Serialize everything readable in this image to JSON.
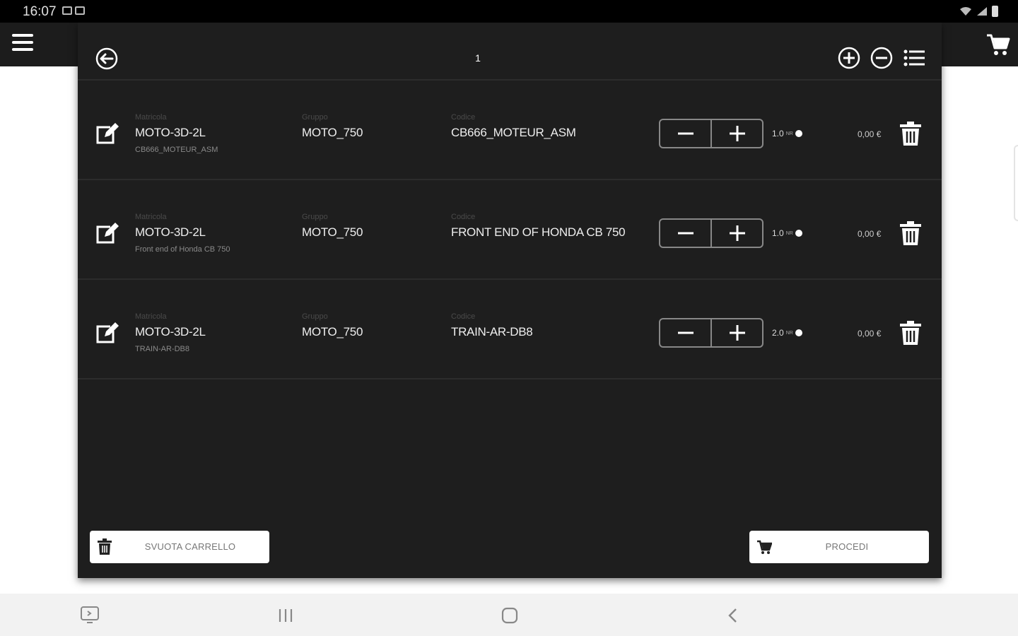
{
  "status": {
    "time": "16:07"
  },
  "header": {
    "title": "1"
  },
  "labels": {
    "matricola": "Matricola",
    "gruppo": "Gruppo",
    "codice": "Codice"
  },
  "items": [
    {
      "matricola": "MOTO-3D-2L",
      "description": "CB666_MOTEUR_ASM",
      "gruppo": "MOTO_750",
      "codice": "CB666_MOTEUR_ASM",
      "qty": "1.0",
      "unit": "NR",
      "price": "0,00 €"
    },
    {
      "matricola": "MOTO-3D-2L",
      "description": "Front end of Honda CB 750",
      "gruppo": "MOTO_750",
      "codice": "FRONT END OF HONDA CB 750",
      "qty": "1.0",
      "unit": "NR",
      "price": "0,00 €"
    },
    {
      "matricola": "MOTO-3D-2L",
      "description": "TRAIN-AR-DB8",
      "gruppo": "MOTO_750",
      "codice": "TRAIN-AR-DB8",
      "qty": "2.0",
      "unit": "NR",
      "price": "0,00 €"
    }
  ],
  "footer": {
    "svuota_label": "SVUOTA CARRELLO",
    "procedi_label": "PROCEDI"
  },
  "colors": {
    "panel": "#1e1e1e",
    "appbar": "#1c1c1c",
    "button_bg": "#ffffff",
    "navbar": "#f2f2f2"
  }
}
